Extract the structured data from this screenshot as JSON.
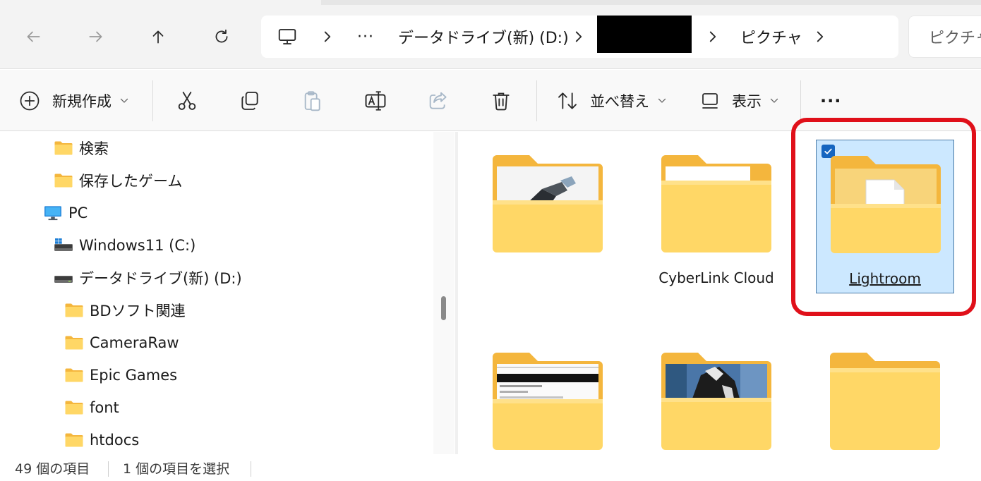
{
  "address_bar": {
    "breadcrumbs": [
      "データドライブ(新) (D:)",
      "ピクチャ"
    ],
    "ellipsis": "···",
    "search_placeholder": "ピクチャ"
  },
  "toolbar": {
    "new_label": "新規作成",
    "sort_label": "並べ替え",
    "view_label": "表示",
    "more_label": "···"
  },
  "nav_pane": {
    "items": [
      {
        "label": "検索",
        "icon": "folder-icon"
      },
      {
        "label": "保存したゲーム",
        "icon": "folder-icon"
      },
      {
        "label": "PC",
        "icon": "pc-icon"
      },
      {
        "label": "Windows11 (C:)",
        "icon": "windows-drive-icon"
      },
      {
        "label": "データドライブ(新) (D:)",
        "icon": "drive-icon"
      },
      {
        "label": "BDソフト関連",
        "icon": "folder-icon"
      },
      {
        "label": "CameraRaw",
        "icon": "folder-icon"
      },
      {
        "label": "Epic Games",
        "icon": "folder-icon"
      },
      {
        "label": "font",
        "icon": "folder-icon"
      },
      {
        "label": "htdocs",
        "icon": "folder-icon"
      }
    ]
  },
  "content": {
    "folders": [
      {
        "name": "",
        "preview": "photo-dark"
      },
      {
        "name": "CyberLink Cloud",
        "preview": "paper"
      },
      {
        "name": "Lightroom",
        "preview": "document",
        "selected": true
      },
      {
        "name": "",
        "preview": "screenshot"
      },
      {
        "name": "",
        "preview": "photo-baseball"
      },
      {
        "name": "",
        "preview": "none"
      }
    ]
  },
  "status": {
    "item_count": "49 個の項目",
    "selected_count": "1 個の項目を選択"
  },
  "colors": {
    "selection_fill": "#cce8ff",
    "highlight_ring": "#e0101a",
    "folder_yellow": "#ffcf48",
    "checkbox_blue": "#1565c0"
  }
}
